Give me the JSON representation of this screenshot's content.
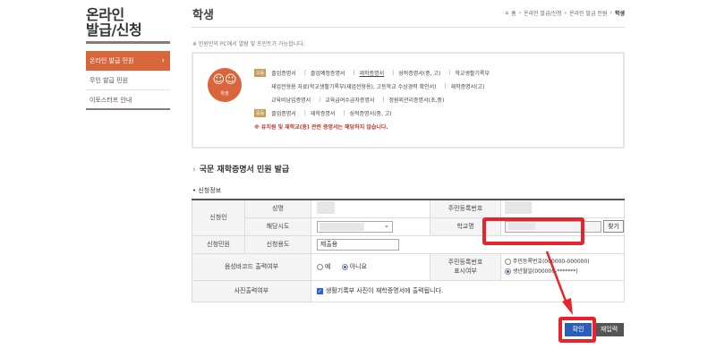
{
  "sidebar": {
    "title_line1": "온라인",
    "title_line2": "발급/신청",
    "items": [
      {
        "label": "온라인 발급 민원"
      },
      {
        "label": "무인 발급 민원"
      },
      {
        "label": "이토스터프 안내"
      }
    ]
  },
  "header": {
    "title": "학생",
    "breadcrumb": [
      "홈",
      "온라인 발급/신청",
      "온라인 발급 민원",
      "학생"
    ]
  },
  "notice": "※ 민원인의 PC에서 열람 및 프린트가 가능합니다.",
  "info": {
    "icon_label": "학생",
    "badge1": "고등",
    "row1": [
      "졸업증명서",
      "졸업예정증명서",
      "재학증명서",
      "성적증명서(중, 고)",
      "학교생활기록부"
    ],
    "row2": [
      "재업전형용 자료(학교생활기록부(재업전형용), 고등학교 수상경력 확인서)",
      "재학증명서(고)"
    ],
    "row3": [
      "교육비납입증명서",
      "교육급여수급자증명서",
      "정원외관리증명서(초,중)"
    ],
    "badge2": "중등",
    "row4": [
      "졸업증명서",
      "재학증명서",
      "성적증명서(중, 고)"
    ],
    "warning": "※ 유치원 및 재학교(중) 관련 증명서는 해당하지 않습니다."
  },
  "section": {
    "title": "국문 재학증명서 민원 발급",
    "subtitle": "• 신청정보"
  },
  "form": {
    "applicant": "신청인",
    "name_label": "성명",
    "resident_label": "주민등록번호",
    "region_label": "해당시도",
    "school_label": "학교명",
    "find_button": "찾기",
    "civil_label": "신청민원",
    "purpose_label": "신청용도",
    "purpose_value": "제출용",
    "barcode_label": "음성바코드 출력여부",
    "yes": "예",
    "no": "아니요",
    "resident_display_label_1": "주민등록번호",
    "resident_display_label_2": "표시여부",
    "opt_resident": "주민등록번호(000000-000000)",
    "opt_birth": "생년월일(000000-*******)",
    "photo_label": "사진출력여부",
    "photo_text": "생활기록부 사진이 재학증명서에 출력됩니다."
  },
  "buttons": {
    "ok": "확인",
    "reset": "재입력"
  },
  "colors": {
    "accent_orange": "#d9663b",
    "highlight_red": "#e8232e",
    "primary_blue": "#2b5eb8"
  }
}
